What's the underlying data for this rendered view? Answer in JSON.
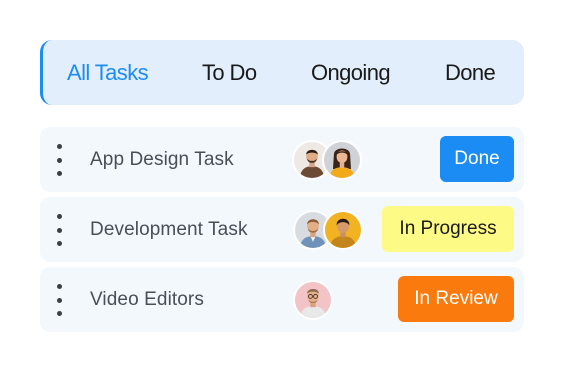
{
  "tabs": [
    {
      "label": "All Tasks",
      "active": true
    },
    {
      "label": "To Do",
      "active": false
    },
    {
      "label": "Ongoing",
      "active": false
    },
    {
      "label": "Done",
      "active": false
    }
  ],
  "tasks": [
    {
      "title": "App Design Task",
      "assignees": [
        "man-brown-shirt-avatar",
        "woman-yellow-top-avatar"
      ],
      "status": "Done",
      "status_color": "#1c8cf5"
    },
    {
      "title": "Development Task",
      "assignees": [
        "man-denim-shirt-avatar",
        "man-yellow-background-avatar"
      ],
      "status": "In Progress",
      "status_color": "#fdfa86"
    },
    {
      "title": "Video Editors",
      "assignees": [
        "man-glasses-pink-background-avatar"
      ],
      "status": "In Review",
      "status_color": "#fb7a0d"
    }
  ],
  "colors": {
    "accent": "#1c8cf5",
    "tab_bar_bg": "#e3eefc",
    "row_bg": "#f3f8fd"
  }
}
